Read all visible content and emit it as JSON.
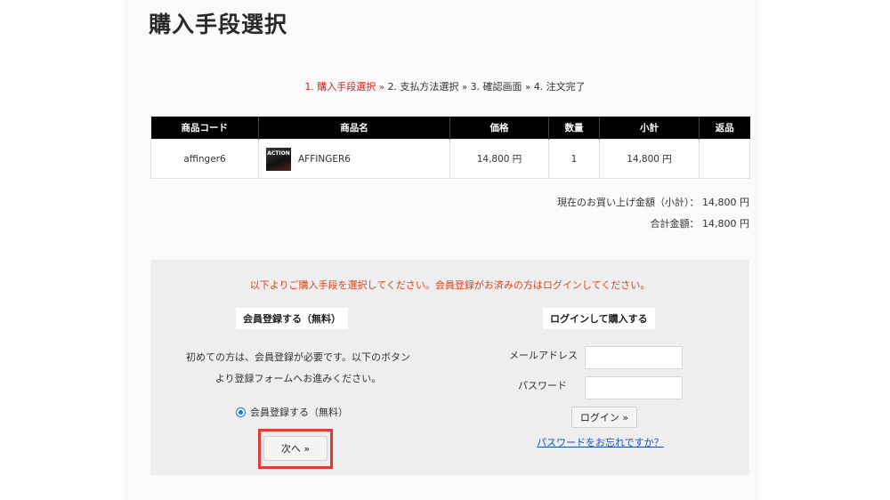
{
  "page": {
    "title": "購入手段選択"
  },
  "steps": {
    "step1": "1. 購入手段選択",
    "step2": "2. 支払方法選択",
    "step3": "3. 確認画面",
    "step4": "4. 注文完了",
    "separator": "»"
  },
  "table": {
    "headers": [
      "商品コード",
      "商品名",
      "価格",
      "数量",
      "小計",
      "返品"
    ],
    "rows": [
      {
        "code": "affinger6",
        "thumb_text": "ACTION",
        "name": "AFFINGER6",
        "price": "14,800 円",
        "qty": "1",
        "subtotal": "14,800 円",
        "returns": ""
      }
    ]
  },
  "totals": {
    "subtotal_label": "現在のお買い上げ金額（小計）：",
    "subtotal_value": "14,800 円",
    "total_label": "合計金額：",
    "total_value": "14,800 円"
  },
  "panel": {
    "notice": "以下よりご購入手段を選択してください。会員登録がお済みの方はログインしてください。",
    "register": {
      "heading": "会員登録する（無料）",
      "desc_line1": "初めての方は、会員登録が必要です。以下のボタン",
      "desc_line2": "より登録フォームへお進みください。",
      "radio_label": "会員登録する（無料）",
      "next_button": "次へ »"
    },
    "login": {
      "heading": "ログインして購入する",
      "email_label": "メールアドレス",
      "password_label": "パスワード",
      "email_value": "",
      "password_value": "",
      "login_button": "ログイン »",
      "forgot_link": "パスワードをお忘れですか？"
    }
  },
  "colors": {
    "accent_red": "#e21a1a",
    "notice": "#e0421b",
    "link": "#1a4fb0",
    "radio": "#1a73e8",
    "highlight_box": "#e53935"
  }
}
